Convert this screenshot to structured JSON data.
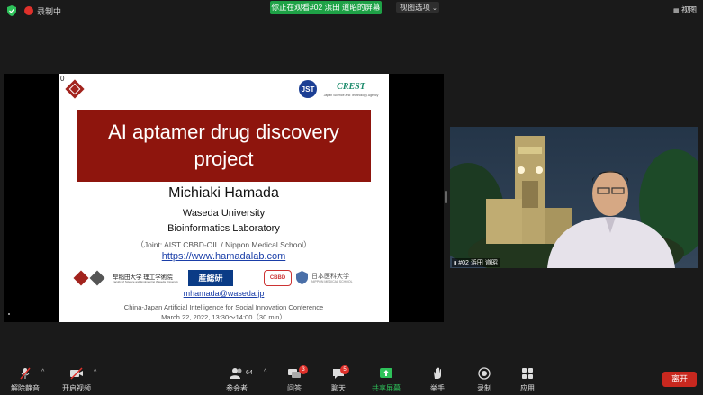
{
  "topbar": {
    "recording_label": "录制中",
    "share_banner": "你正在观看#02 浜田 道昭的屏幕",
    "view_options_label": "视图选项",
    "view_label": "视图"
  },
  "slide": {
    "page_number": "0",
    "title": "AI aptamer drug discovery project",
    "presenter": "Michiaki Hamada",
    "affiliation_1": "Waseda University",
    "affiliation_2": "Bioinformatics Laboratory",
    "joint": "（Joint: AIST CBBD-OIL  / Nippon Medical School）",
    "website": "https://www.hamadalab.com",
    "email": "mhamada@waseda.jp",
    "conference": "China-Japan Artificial Intelligence for Social Innovation Conference",
    "date": "March 22, 2022,  13:30～14:00（30 min）",
    "jst_label": "JST",
    "crest_label": "CREST",
    "crest_sub": "Japan Science and Technology Agency",
    "logo_waseda": "早稲田大学  理工学術院",
    "logo_waseda_sub": "Faculty of Science and Engineering Waseda University",
    "logo_aist": "産総研",
    "logo_cbbd": "CBBD",
    "logo_nms": "日本医科大学",
    "logo_nms_sub": "NIPPON MEDICAL SCHOOL"
  },
  "video": {
    "participant_name": "#02 浜田 道昭"
  },
  "toolbar": {
    "unmute_label": "解除静音",
    "start_video_label": "开启视频",
    "participants_label": "参会者",
    "participants_count": "64",
    "qa_label": "问答",
    "qa_badge": "3",
    "chat_label": "聊天",
    "chat_badge": "5",
    "share_label": "共享屏幕",
    "raise_hand_label": "举手",
    "record_label": "录制",
    "apps_label": "应用",
    "leave_label": "离开"
  },
  "colors": {
    "background": "#1a1a1a",
    "share_green": "#1ea146",
    "slide_title_red": "#8e150d",
    "leave_red": "#c8281f",
    "badge_red": "#e0312b"
  }
}
